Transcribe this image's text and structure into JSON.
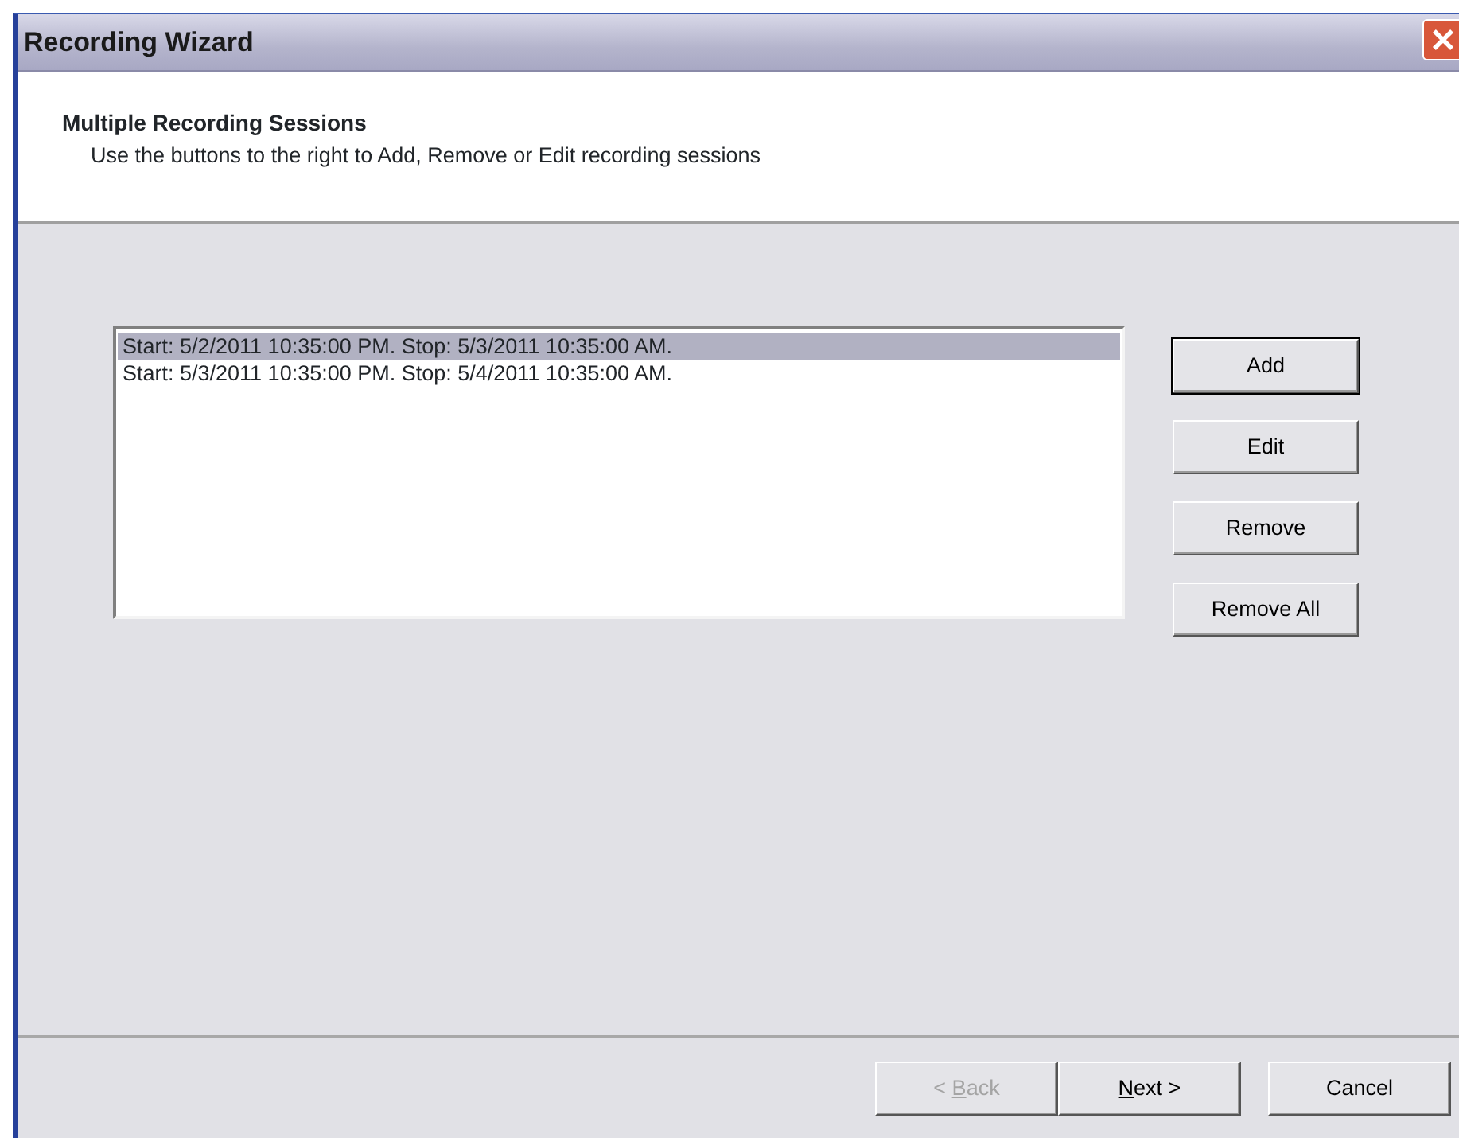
{
  "window": {
    "title": "Recording Wizard"
  },
  "header": {
    "title": "Multiple Recording Sessions",
    "subtitle": "Use the buttons to the right to Add, Remove or Edit recording sessions"
  },
  "sessions": [
    {
      "text": "Start: 5/2/2011 10:35:00 PM. Stop: 5/3/2011 10:35:00 AM.",
      "selected": true
    },
    {
      "text": "Start: 5/3/2011 10:35:00 PM. Stop: 5/4/2011 10:35:00 AM.",
      "selected": false
    }
  ],
  "side_buttons": [
    {
      "label": "Add",
      "default": true
    },
    {
      "label": "Edit",
      "default": false
    },
    {
      "label": "Remove",
      "default": false
    },
    {
      "label": "Remove All",
      "default": false
    }
  ],
  "footer_buttons": [
    {
      "pre": "< ",
      "key": "B",
      "post": "ack",
      "disabled": true
    },
    {
      "key": "N",
      "post": "ext >",
      "disabled": false
    },
    {
      "pre": "Cancel",
      "disabled": false
    }
  ]
}
